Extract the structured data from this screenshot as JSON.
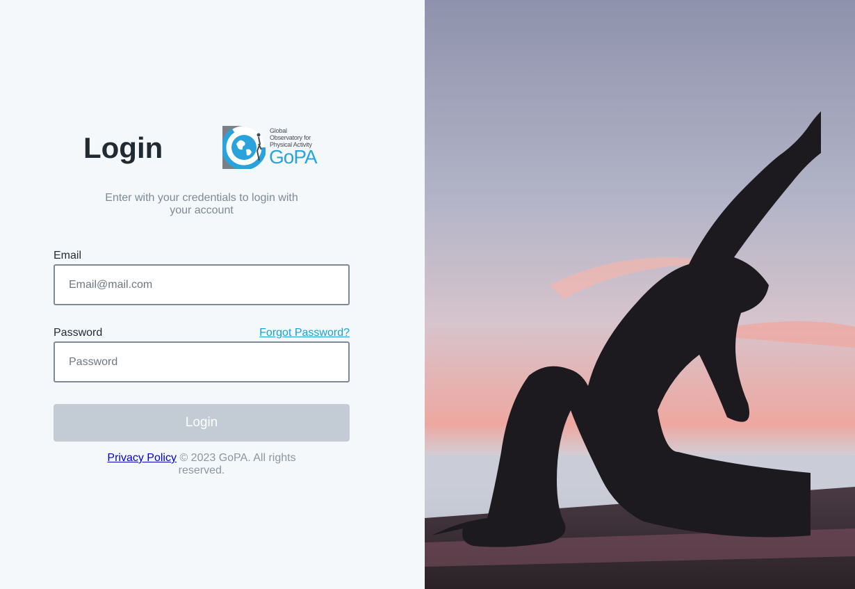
{
  "login": {
    "title": "Login",
    "subtitle": "Enter with your credentials to login with your account",
    "email_label": "Email",
    "email_placeholder": "Email@mail.com",
    "password_label": "Password",
    "password_placeholder": "Password",
    "forgot_password": "Forgot Password?",
    "button_label": "Login"
  },
  "logo": {
    "line1": "Global",
    "line2": "Observatory for",
    "line3": "Physical Activity",
    "mark": "GoPA"
  },
  "footer": {
    "privacy_link": "Privacy Policy",
    "copyright": "© 2023 GoPA. All rights reserved."
  },
  "colors": {
    "accent": "#17a2d8",
    "button_disabled": "#c3ccd4",
    "panel_bg": "#f4f8fb",
    "text": "#1f2a33",
    "muted": "#7d8a96"
  },
  "hero_image": {
    "subject": "yoga-silhouette-sunset"
  }
}
